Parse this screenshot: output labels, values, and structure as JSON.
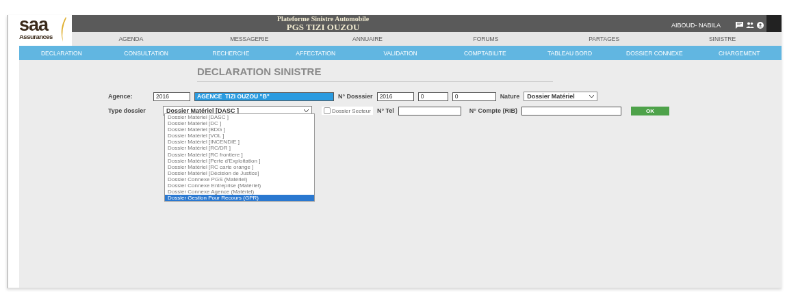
{
  "header": {
    "logo_main": "saa",
    "logo_sub": "Assurances",
    "title_line1": "Plateforme Sinistre Automobile",
    "title_line2": "PGS TIZI OUZOU",
    "user": "AIBOUD- NABILA"
  },
  "top_menu": [
    "AGENDA",
    "MESSAGERIE",
    "ANNUAIRE",
    "FORUMS",
    "PARTAGES",
    "SINISTRE"
  ],
  "nav": [
    "DECLARATION",
    "CONSULTATION",
    "RECHERCHE",
    "AFFECTATION",
    "VALIDATION",
    "COMPTABILITE",
    "TABLEAU BORD",
    "DOSSIER CONNEXE",
    "CHARGEMENT"
  ],
  "form": {
    "heading": "DECLARATION SINISTRE",
    "agence_label": "Agence:",
    "agence_code": "2016",
    "agence_name": "AGENCE  TIZI OUZOU \"B\"",
    "dossier_label": "N° Dosssier",
    "dossier_year": "2016",
    "dossier_part2": "0",
    "dossier_part3": "0",
    "nature_label": "Nature",
    "nature_value": "Dossier Matériel",
    "type_label": "Type dossier",
    "type_value": "Dossier Matériel [DASC ]",
    "secteur": {
      "label": "Dossier Secteur",
      "checked": false
    },
    "tel_label": "N° Tel",
    "compte_label": "N° Compte (RIB)",
    "ok": "OK"
  },
  "type_options": [
    {
      "label": "Dossier Matériel [DASC ]",
      "selected": false
    },
    {
      "label": "Dossier Matériel [DC ]",
      "selected": false
    },
    {
      "label": "Dossier Matériel [BDG ]",
      "selected": false
    },
    {
      "label": "Dossier Matériel [VOL ]",
      "selected": false
    },
    {
      "label": "Dossier Matériel [INCENDIE ]",
      "selected": false
    },
    {
      "label": "Dossier Matériel [RC/DR ]",
      "selected": false
    },
    {
      "label": "Dossier Matériel [RC frontiere ]",
      "selected": false
    },
    {
      "label": "Dossier Matériel [Perte d'Exploitation ]",
      "selected": false
    },
    {
      "label": "Dossier Matériel [RC carte orange ]",
      "selected": false
    },
    {
      "label": "Dossier Matériel [Décision de Justice]",
      "selected": false
    },
    {
      "label": "Dossier Connexe PGS (Matériel)",
      "selected": false
    },
    {
      "label": "Dossier Connexe Entreprise (Matériel)",
      "selected": false
    },
    {
      "label": "Dossier Connexe Agence (Matériel)",
      "selected": false
    },
    {
      "label": "Dossier Gestion Pour Recours (GPR)",
      "selected": true
    }
  ]
}
